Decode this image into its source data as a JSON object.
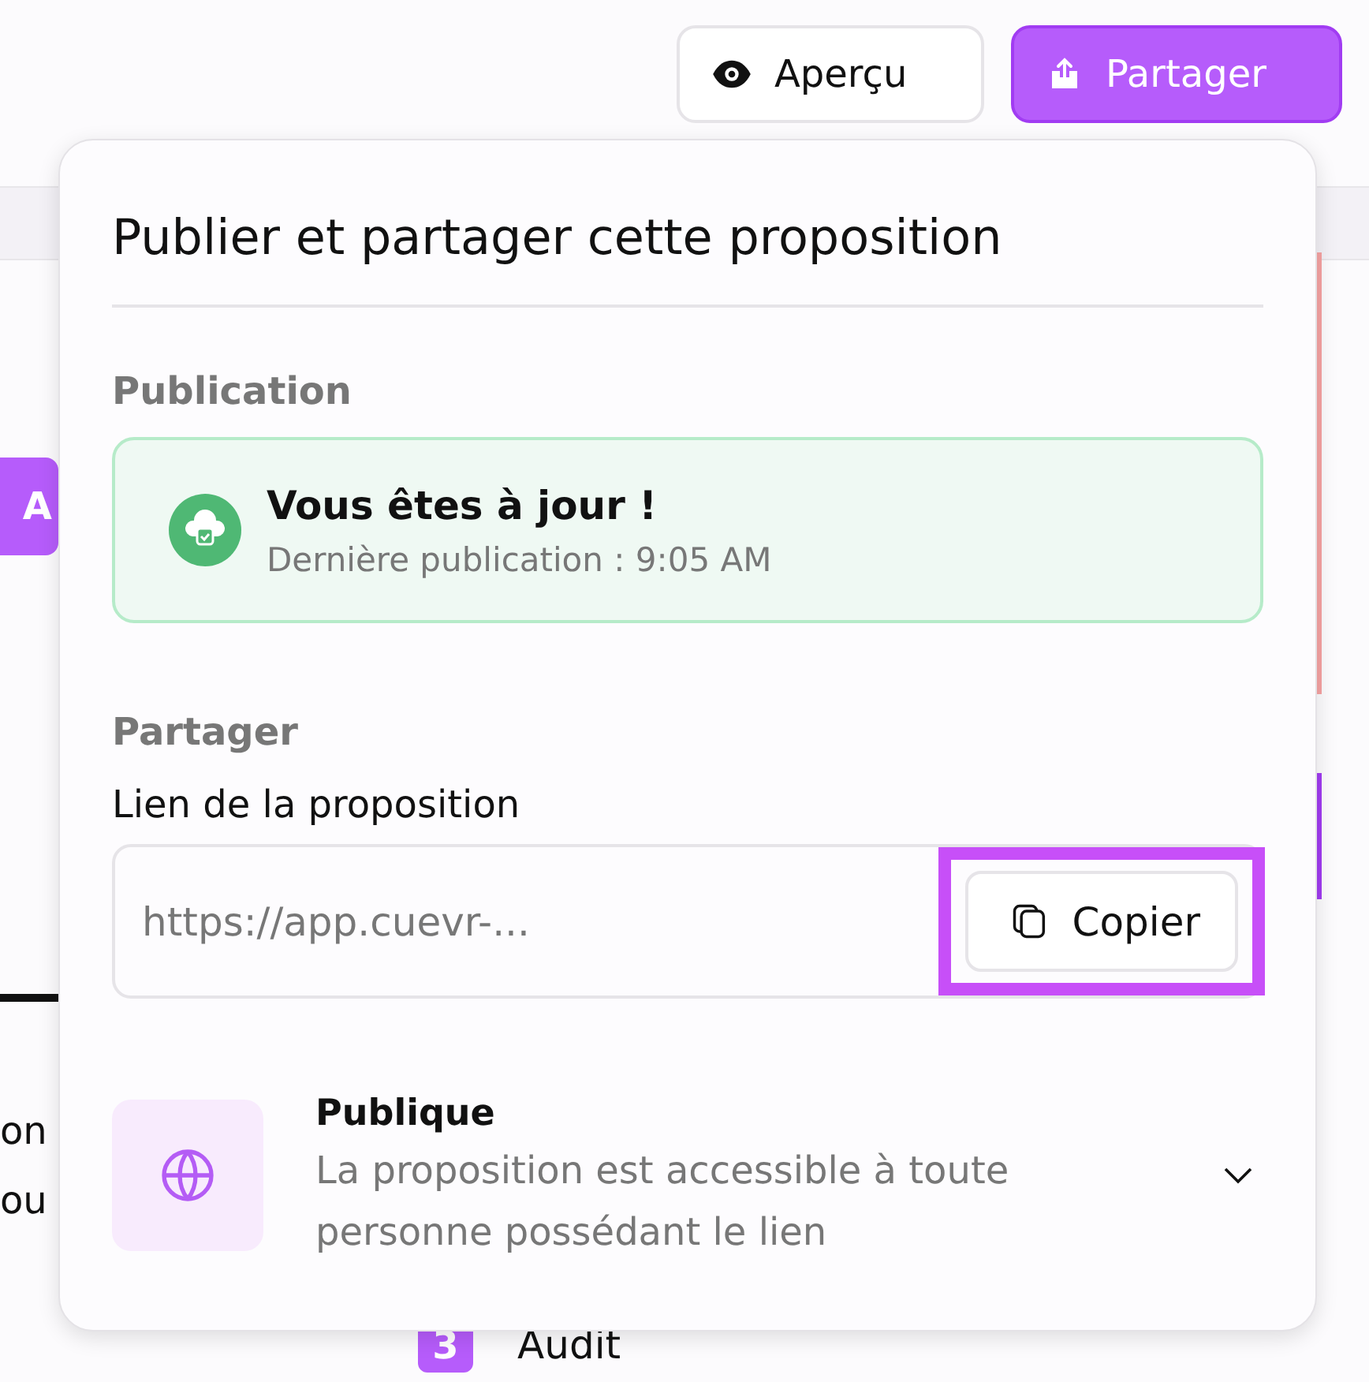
{
  "header": {
    "preview_button": "Aperçu",
    "share_button": "Partager"
  },
  "background": {
    "button_fragment": "A",
    "text_fragments": [
      "on",
      "ou"
    ],
    "step": {
      "number": "3",
      "label": "Audit"
    }
  },
  "popover": {
    "title": "Publier et partager cette proposition",
    "publication": {
      "heading": "Publication",
      "status_title": "Vous êtes à jour !",
      "status_detail": "Dernière publication : 9:05 AM"
    },
    "share": {
      "heading": "Partager",
      "link_label": "Lien de la proposition",
      "link_value": "https://app.cuevr-...",
      "copy_button": {
        "label": "Copier",
        "highlighted": true
      }
    },
    "visibility": {
      "title": "Publique",
      "description": "La proposition est accessible à toute personne possédant le lien",
      "expanded": false
    }
  }
}
